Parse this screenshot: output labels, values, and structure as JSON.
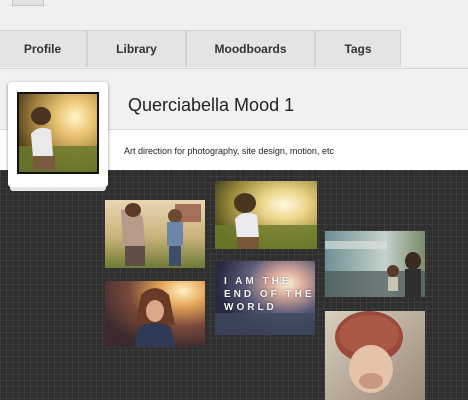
{
  "nav": {
    "tabs": [
      {
        "label": "Profile"
      },
      {
        "label": "Library"
      },
      {
        "label": "Moodboards"
      },
      {
        "label": "Tags"
      }
    ]
  },
  "board": {
    "title": "Querciabella Mood 1",
    "description": "Art direction for photography, site design, motion, etc"
  },
  "tiles": [
    {
      "name": "mother-child-field-photo"
    },
    {
      "name": "sunset-child-meadow-photo"
    },
    {
      "name": "child-porch-photo"
    },
    {
      "name": "girl-sunflare-photo"
    },
    {
      "name": "end-of-world-poster",
      "overlay_text": "I AM THE\nEND OF THE\nWORLD"
    },
    {
      "name": "child-knit-hat-photo"
    }
  ],
  "colors": {
    "grid_background": "#2f2f2f",
    "tab_background": "#e4e4e4",
    "header_background": "#f1f1f1"
  }
}
